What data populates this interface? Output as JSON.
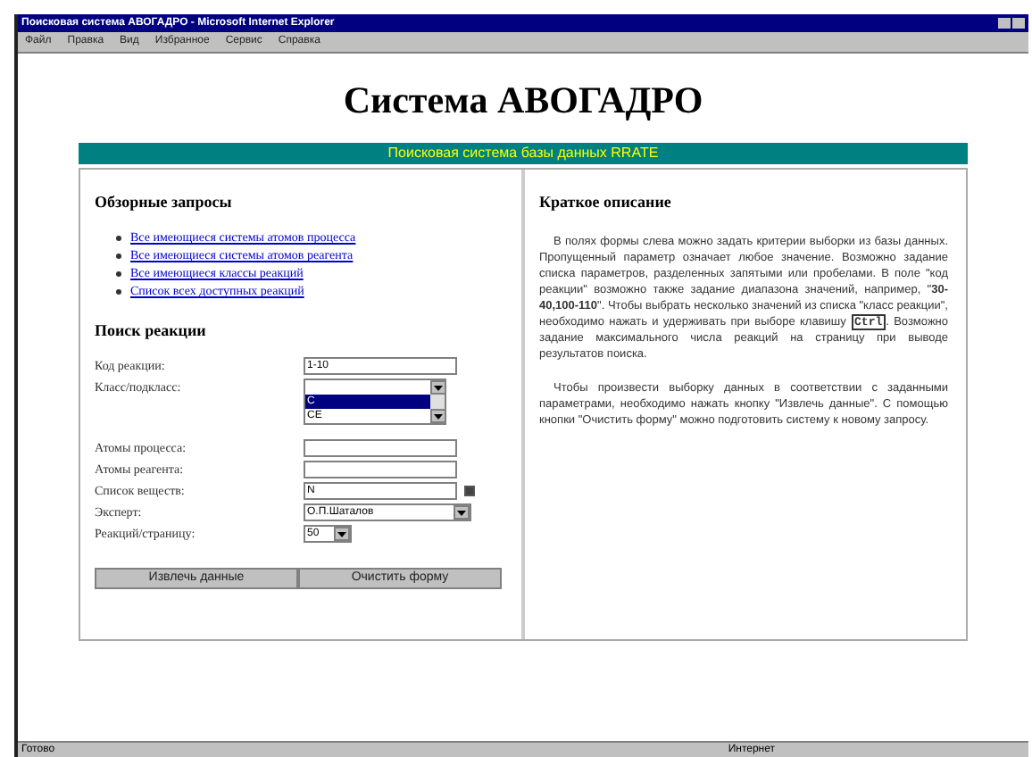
{
  "window": {
    "title": "Поисковая система АВОГАДРО - Microsoft Internet Explorer"
  },
  "menu": [
    "Файл",
    "Правка",
    "Вид",
    "Избранное",
    "Сервис",
    "Справка"
  ],
  "page_title": "Система АВОГАДРО",
  "banner": "Поисковая система базы данных RRATE",
  "overview": {
    "heading": "Обзорные запросы",
    "links": [
      "Все имеющиеся системы атомов процесса",
      "Все имеющиеся системы атомов реагента",
      "Все имеющиеся классы реакций",
      "Список всех доступных реакций"
    ]
  },
  "search": {
    "heading": "Поиск реакции",
    "fields": [
      {
        "kind": "text",
        "label": "Код реакции:",
        "value": "1-10"
      },
      {
        "kind": "listbox",
        "label": "Класс/подкласс:",
        "options": [
          {
            "text": "C",
            "selected": true
          },
          {
            "text": "CE",
            "selected": false
          }
        ]
      },
      {
        "kind": "text",
        "label": "Атомы процесса:"
      },
      {
        "kind": "text",
        "label": "Атомы реагента:"
      },
      {
        "kind": "text_check",
        "label": "Список веществ:",
        "value": "N",
        "checked": true
      },
      {
        "kind": "select",
        "label": "Эксперт:",
        "value": "О.П.Шаталов"
      },
      {
        "kind": "short_select",
        "label": "Реакций/страницу:",
        "value": "50"
      }
    ],
    "buttons": [
      "Извлечь данные",
      "Очистить форму"
    ]
  },
  "description": {
    "heading": "Краткое описание",
    "paragraphs": [
      {
        "before": "В полях формы слева можно задать критерии выборки из базы данных. Пропущенный параметр означает любое значение. Возможно задание списка параметров, разделенных запятыми или пробелами. В поле \"код реакции\" возможно также задание диапазона значений, например, \"**30-40,100-110**\". Чтобы выбрать несколько значений из списка \"класс реакции\", необходимо нажать и удерживать при выборе клавишу",
        "key": "Ctrl",
        "after": ". Возможно задание максимального числа реакций на страницу при выводе результатов поиска."
      },
      {
        "before": "Чтобы произвести выборку данных в соответствии с заданными параметрами, необходимо нажать кнопку \"Извлечь данные\". С помощью кнопки \"Очистить форму\" можно подготовить систему к новому запросу."
      }
    ]
  },
  "status_bar": {
    "text": "Готово",
    "zone": "Интернет"
  }
}
